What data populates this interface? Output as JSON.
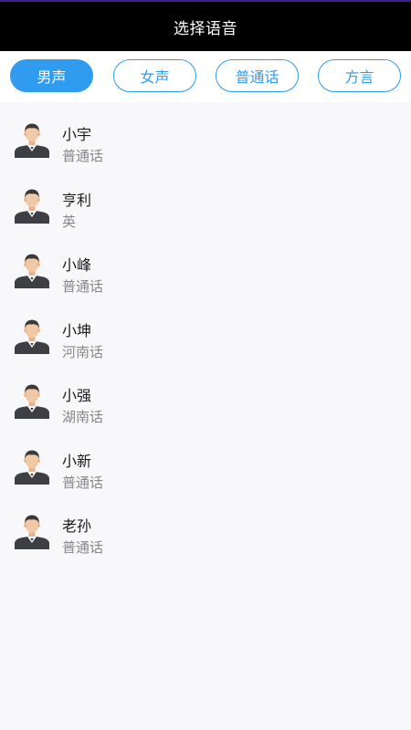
{
  "header": {
    "title": "选择语音"
  },
  "tabs": [
    {
      "label": "男声",
      "active": true
    },
    {
      "label": "女声",
      "active": false
    },
    {
      "label": "普通话",
      "active": false
    },
    {
      "label": "方言",
      "active": false
    }
  ],
  "voices": [
    {
      "name": "小宇",
      "dialect": "普通话",
      "icon": "male-avatar-icon"
    },
    {
      "name": "亨利",
      "dialect": "英",
      "icon": "male-avatar-icon"
    },
    {
      "name": "小峰",
      "dialect": "普通话",
      "icon": "male-avatar-icon"
    },
    {
      "name": "小坤",
      "dialect": "河南话",
      "icon": "male-avatar-icon"
    },
    {
      "name": "小强",
      "dialect": "湖南话",
      "icon": "male-avatar-icon"
    },
    {
      "name": "小新",
      "dialect": "普通话",
      "icon": "male-avatar-icon"
    },
    {
      "name": "老孙",
      "dialect": "普通话",
      "icon": "male-avatar-icon"
    }
  ],
  "colors": {
    "accent": "#2f9cf0",
    "header_bg": "#000000",
    "page_bg": "#f8f7fa",
    "secondary_text": "#888888"
  }
}
